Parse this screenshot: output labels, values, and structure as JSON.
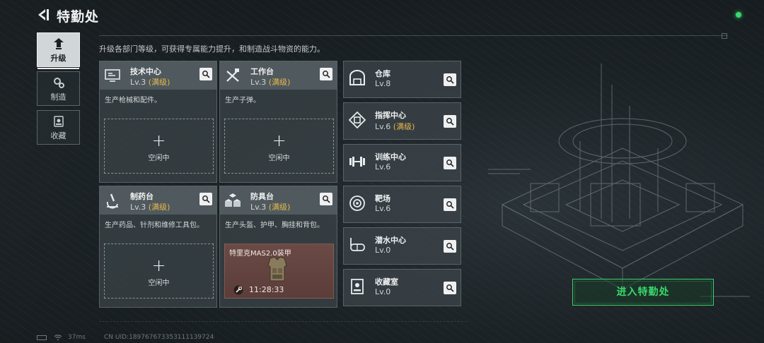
{
  "header": {
    "title": "特勤处",
    "subtitle": "升级各部门等级，可获得专属能力提升，和制造战斗物资的能力。"
  },
  "tabs": [
    {
      "label": "升级",
      "icon": "upgrade-icon",
      "active": true
    },
    {
      "label": "制造",
      "icon": "gears-icon",
      "active": false
    },
    {
      "label": "收藏",
      "icon": "collection-icon",
      "active": false
    }
  ],
  "cards": [
    {
      "name": "技术中心",
      "level": "Lv.3",
      "max": "(满级)",
      "desc": "生产枪械和配件。",
      "slot": "空闲中",
      "icon": "monitor-icon"
    },
    {
      "name": "工作台",
      "level": "Lv.3",
      "max": "(满级)",
      "desc": "生产子弹。",
      "slot": "空闲中",
      "icon": "tools-icon"
    },
    {
      "name": "制药台",
      "level": "Lv.3",
      "max": "(满级)",
      "desc": "生产药品、针剂和维修工具包。",
      "slot": "空闲中",
      "icon": "microscope-icon"
    },
    {
      "name": "防具台",
      "level": "Lv.3",
      "max": "(满级)",
      "desc": "生产头盔、护甲、胸挂和背包。",
      "craft_item": "特里克MAS2.0装甲",
      "craft_timer": "11:28:33",
      "icon": "boxes-icon"
    }
  ],
  "facilities": [
    {
      "name": "仓库",
      "level": "Lv.8",
      "max": "",
      "icon": "warehouse-icon"
    },
    {
      "name": "指挥中心",
      "level": "Lv.6",
      "max": "(满级)",
      "icon": "chip-icon"
    },
    {
      "name": "训练中心",
      "level": "Lv.6",
      "max": "",
      "icon": "dumbbell-icon"
    },
    {
      "name": "靶场",
      "level": "Lv.6",
      "max": "",
      "icon": "target-icon"
    },
    {
      "name": "潜水中心",
      "level": "Lv.0",
      "max": "",
      "icon": "diving-mask-icon"
    },
    {
      "name": "收藏室",
      "level": "Lv.0",
      "max": "",
      "icon": "display-case-icon"
    }
  ],
  "enter_button": "进入特勤处",
  "footer": {
    "ping": "37ms",
    "uid": "CN UID:189767673353111139724"
  },
  "colors": {
    "accent_green": "#39d86b",
    "max_level_gold": "#e5b84b",
    "craft_bg": "#6b4a45"
  }
}
